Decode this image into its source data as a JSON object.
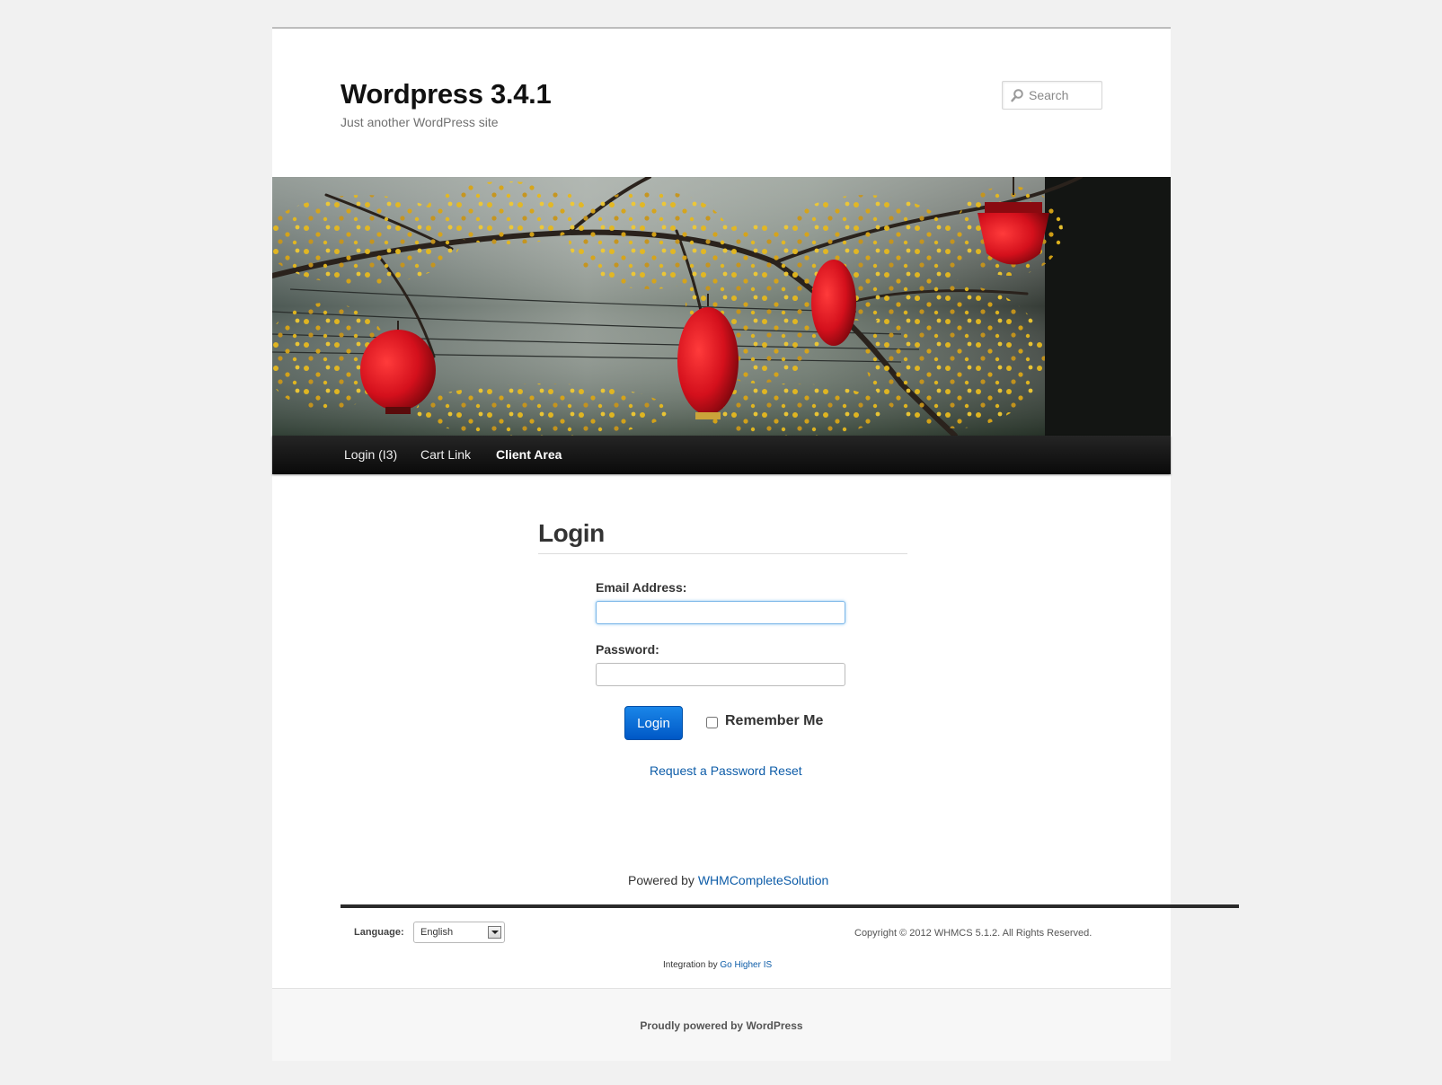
{
  "header": {
    "site_title": "Wordpress 3.4.1",
    "site_description": "Just another WordPress site",
    "search_placeholder": "Search"
  },
  "nav": {
    "items": [
      {
        "label": "Login (I3)"
      },
      {
        "label": "Cart Link"
      },
      {
        "label": "Client Area"
      }
    ]
  },
  "login": {
    "heading": "Login",
    "email_label": "Email Address:",
    "email_value": "",
    "password_label": "Password:",
    "password_value": "",
    "button_label": "Login",
    "remember_label": "Remember Me",
    "remember_checked": false,
    "reset_link": "Request a Password Reset"
  },
  "whmcs_footer": {
    "powered_prefix": "Powered by ",
    "powered_link": "WHMCompleteSolution",
    "language_label": "Language:",
    "language_value": "English",
    "copyright": "Copyright © 2012 WHMCS 5.1.2. All Rights Reserved.",
    "integration_prefix": "Integration by ",
    "integration_link": "Go Higher IS"
  },
  "site_footer": {
    "credit": "Proudly powered by WordPress"
  },
  "colors": {
    "link": "#0d5ca8",
    "button": "#0a6ad6",
    "nav_bg": "#161616",
    "lantern_red": "#d4101c",
    "blossom_yellow": "#e6b91e"
  }
}
